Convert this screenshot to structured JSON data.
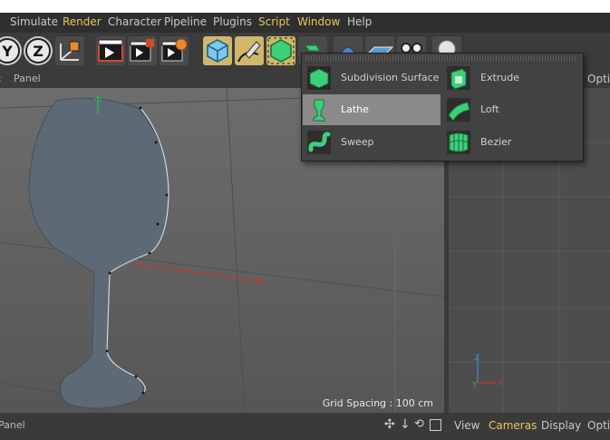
{
  "menu": {
    "items": [
      {
        "label": "Simulate",
        "highlight": false
      },
      {
        "label": "Render",
        "highlight": true
      },
      {
        "label": "Character",
        "highlight": false
      },
      {
        "label": "Pipeline",
        "highlight": false
      },
      {
        "label": "Plugins",
        "highlight": false
      },
      {
        "label": "Script",
        "highlight": true
      },
      {
        "label": "Window",
        "highlight": true
      },
      {
        "label": "Help",
        "highlight": false
      }
    ]
  },
  "viewport": {
    "panel_label": "Panel",
    "grid_spacing": "Grid Spacing : 100 cm"
  },
  "right_panel": {
    "header_label": "Optic",
    "bottom_menu": [
      "View",
      "Cameras",
      "Display",
      "Optio"
    ]
  },
  "bottom": {
    "panel_label": "Panel"
  },
  "popup": {
    "items": [
      {
        "label": "Subdivision Surface",
        "icon": "subdivision-surface-icon"
      },
      {
        "label": "Extrude",
        "icon": "extrude-icon"
      },
      {
        "label": "Lathe",
        "icon": "lathe-icon",
        "active": true
      },
      {
        "label": "Loft",
        "icon": "loft-icon"
      },
      {
        "label": "Sweep",
        "icon": "sweep-icon"
      },
      {
        "label": "Bezier",
        "icon": "bezier-icon"
      }
    ]
  },
  "colors": {
    "accent_yellow": "#e8c65a",
    "generator_green": "#3dcf7a",
    "axis_red": "#d03030"
  },
  "axis_labels": {
    "y": "Y",
    "x": "X"
  }
}
